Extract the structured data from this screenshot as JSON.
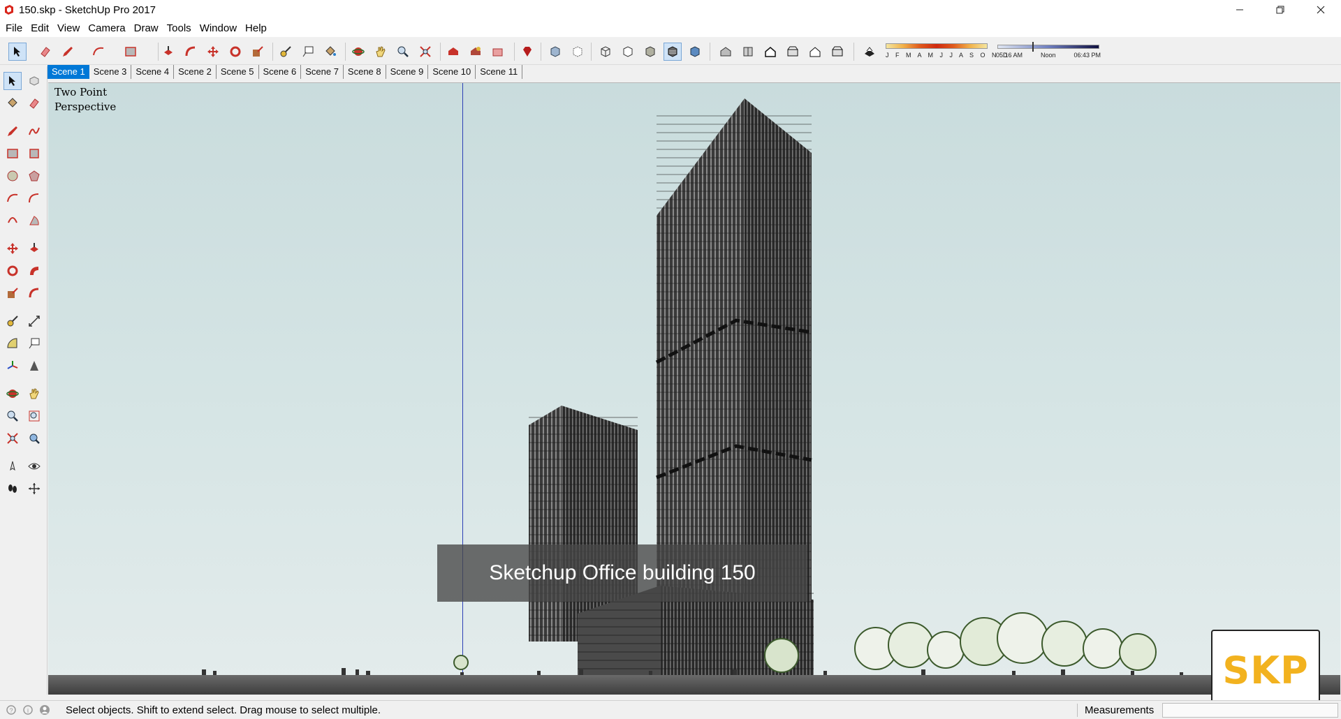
{
  "window": {
    "title": "150.skp - SketchUp Pro 2017"
  },
  "menu": [
    "File",
    "Edit",
    "View",
    "Camera",
    "Draw",
    "Tools",
    "Window",
    "Help"
  ],
  "shadow_settings": {
    "months": "J F M A M J J A S O N D",
    "time_start": "05:16 AM",
    "time_mid": "Noon",
    "time_end": "06:43 PM"
  },
  "scenes": [
    "Scene 1",
    "Scene 3",
    "Scene 4",
    "Scene 2",
    "Scene 5",
    "Scene 6",
    "Scene 7",
    "Scene 8",
    "Scene 9",
    "Scene 10",
    "Scene 11"
  ],
  "active_scene": "Scene 1",
  "viewport": {
    "perspective_label": "Two Point\nPerspective",
    "caption": "Sketchup Office building 150",
    "logo": "SKP"
  },
  "status": {
    "message": "Select objects. Shift to extend select. Drag mouse to select multiple.",
    "measurements_label": "Measurements",
    "measurements_value": ""
  }
}
